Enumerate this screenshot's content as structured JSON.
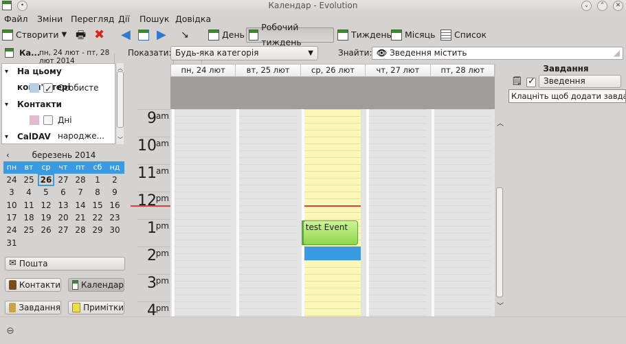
{
  "window": {
    "title": "Календар - Evolution"
  },
  "menu": [
    {
      "label": "Файл"
    },
    {
      "label": "Зміни"
    },
    {
      "label": "Перегляд"
    },
    {
      "label": "Дії"
    },
    {
      "label": "Пошук"
    },
    {
      "label": "Довідка"
    }
  ],
  "toolbar": {
    "new_label": "Створити",
    "views": [
      {
        "label": "День"
      },
      {
        "label": "Робочий тиждень"
      },
      {
        "label": "Тиждень"
      },
      {
        "label": "Місяць"
      },
      {
        "label": "Список"
      }
    ],
    "active_view": "Робочий тиждень"
  },
  "sidebar": {
    "header_title": "Ка...",
    "date_range": "пн, 24 лют - пт, 28 лют 2014",
    "tree": [
      {
        "type": "group",
        "label": "На цьому комп'ютері"
      },
      {
        "type": "item",
        "label": "Особисте",
        "checked": true,
        "color": "#b9cde3"
      },
      {
        "type": "group",
        "label": "Контакти"
      },
      {
        "type": "item",
        "label": "Дні народже...",
        "checked": false,
        "color": "#e3b9d0"
      },
      {
        "type": "group",
        "label": "CalDAV"
      }
    ],
    "minical": {
      "month_label": "березень 2014",
      "weekdays": [
        "пн",
        "вт",
        "ср",
        "чт",
        "пт",
        "сб",
        "нд"
      ],
      "weeks": [
        [
          "24",
          "25",
          "26",
          "27",
          "28",
          "1",
          "2"
        ],
        [
          "3",
          "4",
          "5",
          "6",
          "7",
          "8",
          "9"
        ],
        [
          "10",
          "11",
          "12",
          "13",
          "14",
          "15",
          "16"
        ],
        [
          "17",
          "18",
          "19",
          "20",
          "21",
          "22",
          "23"
        ],
        [
          "24",
          "25",
          "26",
          "27",
          "28",
          "29",
          "30"
        ],
        [
          "31",
          "",
          "",
          "",
          "",
          "",
          ""
        ]
      ],
      "today": "26"
    },
    "mail_label": "Пошта",
    "buttons": [
      {
        "label": "Контакти"
      },
      {
        "label": "Календар"
      },
      {
        "label": "Завдання"
      },
      {
        "label": "Примітки"
      }
    ]
  },
  "filter": {
    "show_label": "Показати:",
    "category_value": "Будь-яка категорія",
    "find_label": "Знайти:",
    "search_value": "Зведення містить"
  },
  "calendar": {
    "days": [
      "пн, 24 лют",
      "вт, 25 лют",
      "ср, 26 лют",
      "чт, 27 лют",
      "пт, 28 лют"
    ],
    "today_index": 2,
    "hours": [
      {
        "h": "9",
        "ap": "am"
      },
      {
        "h": "10",
        "ap": "am"
      },
      {
        "h": "11",
        "ap": "am"
      },
      {
        "h": "12",
        "ap": "pm"
      },
      {
        "h": "1",
        "ap": "pm"
      },
      {
        "h": "2",
        "ap": "pm"
      },
      {
        "h": "3",
        "ap": "pm"
      },
      {
        "h": "4",
        "ap": "pm"
      }
    ],
    "event": {
      "title": "test Event",
      "day_index": 2,
      "start": "13:00",
      "end": "14:00"
    },
    "selection": {
      "day_index": 2,
      "start": "14:00",
      "end": "14:30"
    },
    "now_time": "12:30"
  },
  "tasks": {
    "header": "Завдання",
    "column_label": "Зведення",
    "add_hint": "Клацніть щоб додати завдання"
  },
  "colors": {
    "accent": "#3c9ae2",
    "event": "#8fd64d",
    "today_bg": "#fbf7b9",
    "now_line": "#e23c3c"
  }
}
